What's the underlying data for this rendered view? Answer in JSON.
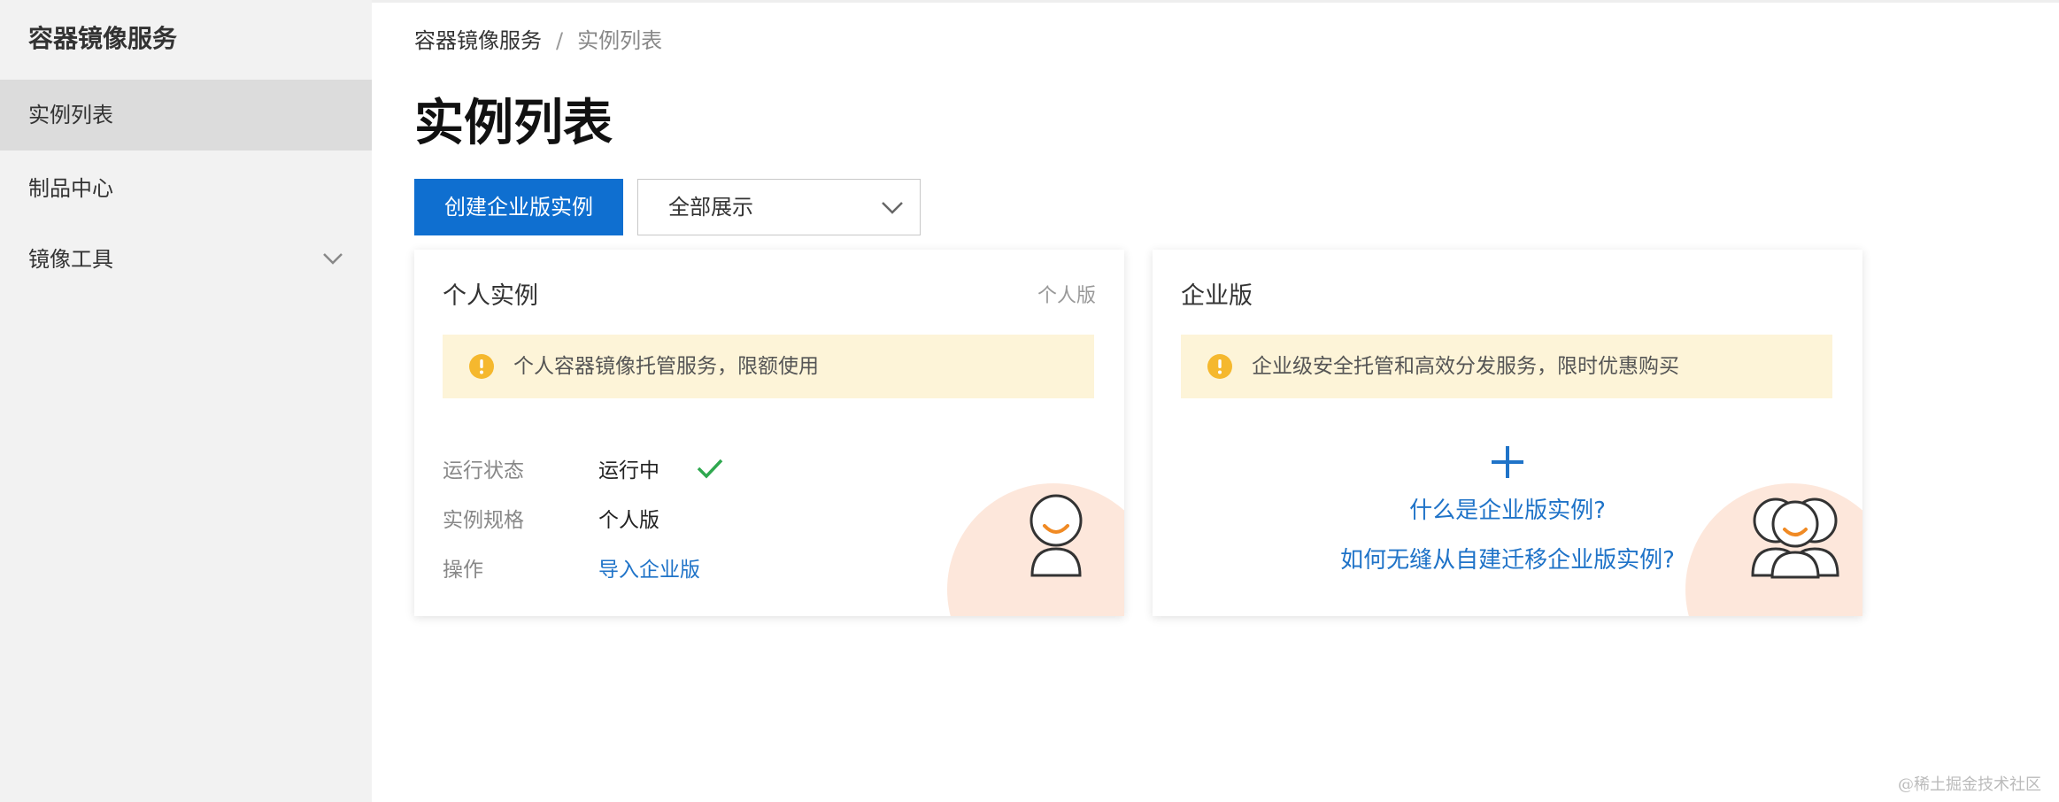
{
  "sidebar": {
    "title": "容器镜像服务",
    "items": [
      {
        "label": "实例列表",
        "active": true
      },
      {
        "label": "制品中心",
        "active": false
      },
      {
        "label": "镜像工具",
        "active": false,
        "expandable": true
      }
    ]
  },
  "breadcrumb": {
    "root": "容器镜像服务",
    "separator": "/",
    "current": "实例列表"
  },
  "page": {
    "title": "实例列表"
  },
  "toolbar": {
    "create_label": "创建企业版实例",
    "filter_value": "全部展示"
  },
  "cards": {
    "personal": {
      "title": "个人实例",
      "tag": "个人版",
      "notice": "个人容器镜像托管服务，限额使用",
      "rows": [
        {
          "label": "运行状态",
          "value": "运行中"
        },
        {
          "label": "实例规格",
          "value": "个人版"
        },
        {
          "label": "操作",
          "value": "导入企业版"
        }
      ]
    },
    "enterprise": {
      "title": "企业版",
      "notice": "企业级安全托管和高效分发服务，限时优惠购买",
      "link_what": "什么是企业版实例?",
      "link_migrate": "如何无缝从自建迁移企业版实例?"
    }
  },
  "watermark": "@稀土掘金技术社区",
  "colors": {
    "primary": "#0f6fd0",
    "link": "#1f73c8",
    "notice_bg": "#fdf4d8",
    "warning": "#f5b82e",
    "success": "#2fa84f",
    "accent_orange": "#f08a24"
  },
  "icons": {
    "status": "check-icon",
    "notice": "warning-icon",
    "add": "plus-icon",
    "expand": "chevron-down-icon"
  }
}
